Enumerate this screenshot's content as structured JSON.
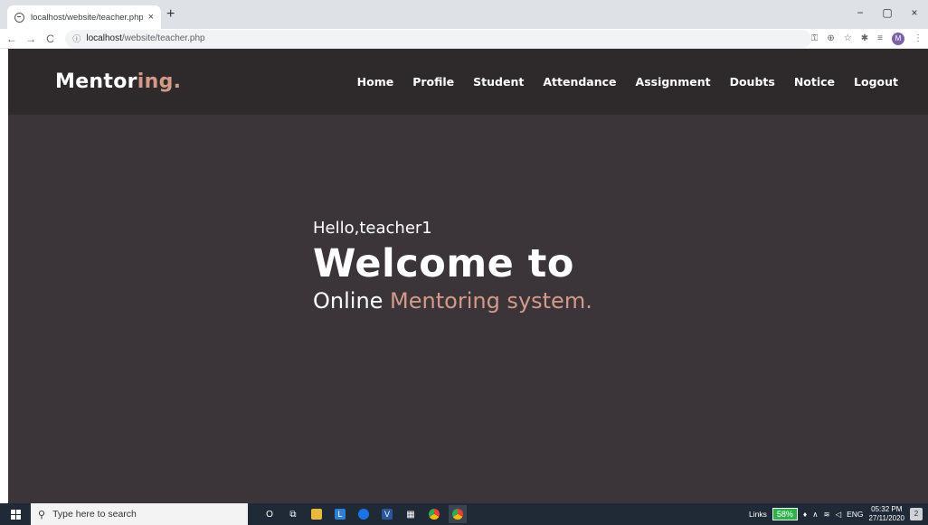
{
  "browser": {
    "tab_title": "localhost/website/teacher.php",
    "tab_close": "×",
    "new_tab": "+",
    "window_controls": {
      "minimize": "−",
      "maximize": "▢",
      "close": "×"
    },
    "nav": {
      "back": "←",
      "forward": "→",
      "reload": "C"
    },
    "address": {
      "info_icon": "ⓘ",
      "host": "localhost",
      "path": "/website/teacher.php"
    },
    "toolbar_icons": [
      "key-icon",
      "zoom-icon",
      "star-icon",
      "extensions-icon",
      "reading-list-icon"
    ],
    "profile_initial": "M",
    "menu_icon": "⋮"
  },
  "site": {
    "logo": {
      "main": "Mentor",
      "accent": "ing."
    },
    "menu": [
      "Home",
      "Profile",
      "Student",
      "Attendance",
      "Assignment",
      "Doubts",
      "Notice",
      "Logout"
    ]
  },
  "hero": {
    "greeting": "Hello,teacher1",
    "welcome": "Welcome to",
    "subline_plain": "Online ",
    "subline_accent": "Mentoring system."
  },
  "taskbar": {
    "search_placeholder": "Type here to search",
    "apps": [
      {
        "name": "cortana-icon",
        "glyph": "O"
      },
      {
        "name": "task-view-icon",
        "glyph": "⧉"
      },
      {
        "name": "file-explorer-icon",
        "color": "#e8b93c"
      },
      {
        "name": "app-l-icon",
        "color": "#2d7fd3",
        "glyph": "L"
      },
      {
        "name": "app-globe-icon",
        "color": "#1a73e8"
      },
      {
        "name": "app-vs-icon",
        "color": "#2b579a",
        "glyph": "V"
      },
      {
        "name": "calculator-icon",
        "glyph": "▦"
      },
      {
        "name": "chrome-icon",
        "color": "#e94235"
      },
      {
        "name": "chrome-active-icon",
        "color": "#e94235"
      }
    ],
    "tray": {
      "links": "Links",
      "battery": "58%",
      "lang": "ENG",
      "time": "05:32 PM",
      "date": "27/11/2020",
      "notifications": "2"
    }
  }
}
